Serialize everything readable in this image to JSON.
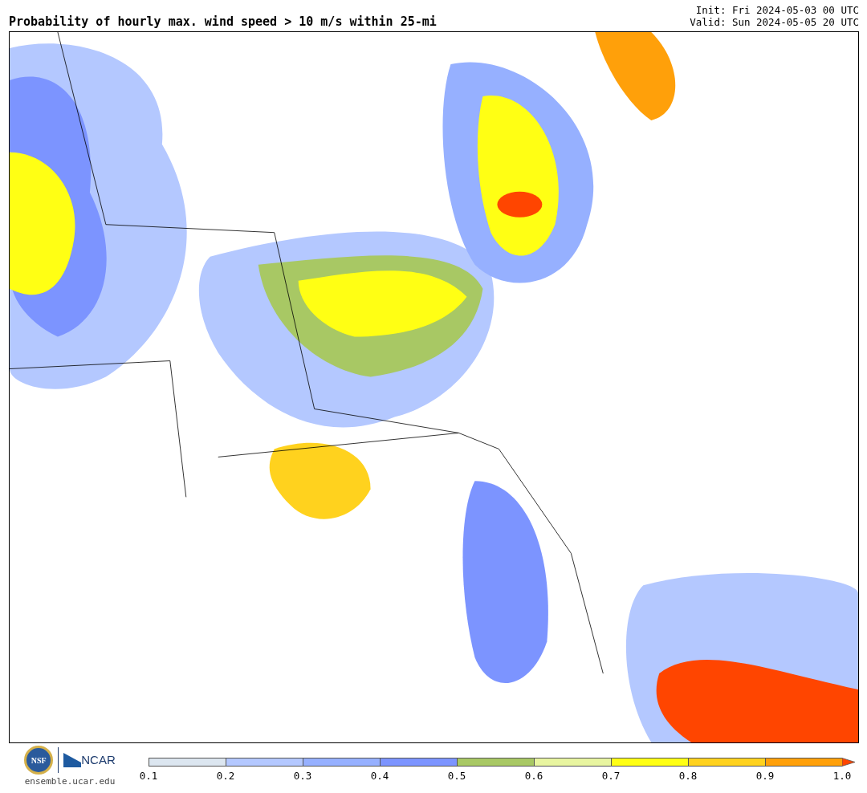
{
  "title": "Probability of hourly max. wind speed > 10 m/s within 25-mi",
  "init": "Init: Fri 2024-05-03 00 UTC",
  "valid": "Valid: Sun 2024-05-05 20 UTC",
  "logos": {
    "nsf": "NSF",
    "ncar": "NCAR",
    "url": "ensemble.ucar.edu"
  },
  "colorbar": {
    "segments": [
      {
        "color": "#dce6f0"
      },
      {
        "color": "#b4c8ff"
      },
      {
        "color": "#96b0ff"
      },
      {
        "color": "#7c94ff"
      },
      {
        "color": "#a8c864"
      },
      {
        "color": "#e8f5a0"
      },
      {
        "color": "#ffff14"
      },
      {
        "color": "#ffd21e"
      },
      {
        "color": "#ffa00a"
      },
      {
        "color": "#ff4500",
        "kind": "arrow"
      }
    ],
    "ticks": [
      "0.1",
      "0.2",
      "0.3",
      "0.4",
      "0.5",
      "0.6",
      "0.7",
      "0.8",
      "0.9",
      "1.0"
    ]
  }
}
